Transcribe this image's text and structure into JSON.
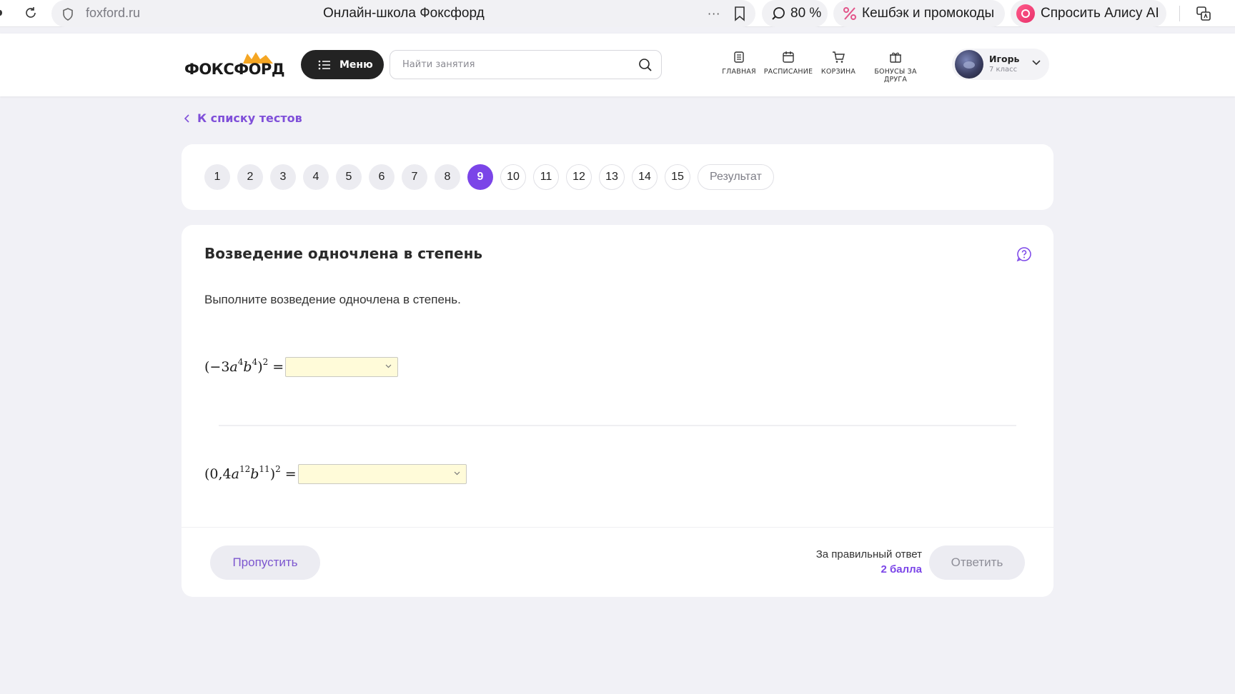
{
  "browser": {
    "url": "foxford.ru",
    "tab_title": "Онлайн-школа Фоксфорд",
    "more_label": "···",
    "zoom_label": "80 %",
    "cashback_label": "Кешбэк и промокоды",
    "alice_label": "Спросить Алису AI"
  },
  "header": {
    "logo_text": "ФОКСФОРД",
    "menu_label": "Меню",
    "search_placeholder": "Найти занятия",
    "nav": [
      {
        "label": "ГЛАВНАЯ",
        "icon": "document-icon"
      },
      {
        "label": "РАСПИСАНИЕ",
        "icon": "calendar-icon"
      },
      {
        "label": "КОРЗИНА",
        "icon": "cart-icon"
      },
      {
        "label": "БОНУСЫ ЗА ДРУГА",
        "icon": "gift-icon"
      }
    ],
    "user": {
      "name": "Игорь",
      "grade": "7 класс"
    }
  },
  "back_link": "К списку тестов",
  "pager": {
    "questions": [
      "1",
      "2",
      "3",
      "4",
      "5",
      "6",
      "7",
      "8",
      "9",
      "10",
      "11",
      "12",
      "13",
      "14",
      "15"
    ],
    "current": "9",
    "result_label": "Результат"
  },
  "question": {
    "title": "Возведение одночлена в степень",
    "instruction": "Выполните возведение одночлена в степень.",
    "expr1": {
      "open": "(−3",
      "a": "a",
      "a_exp": "4",
      "b": "b",
      "b_exp": "4",
      "close": ")",
      "power": "2",
      "eq": " ="
    },
    "expr2": {
      "open": "(0,4",
      "a": "a",
      "a_exp": "12",
      "b": "b",
      "b_exp": "11",
      "close": ")",
      "power": "2",
      "eq": " ="
    }
  },
  "footer": {
    "skip_label": "Пропустить",
    "points_caption": "За правильный ответ",
    "points_value": "2 балла",
    "answer_label": "Ответить"
  },
  "colors": {
    "accent": "#7b45e8",
    "select_bg": "#fffbd9",
    "page_bg": "#f1f1f6"
  }
}
